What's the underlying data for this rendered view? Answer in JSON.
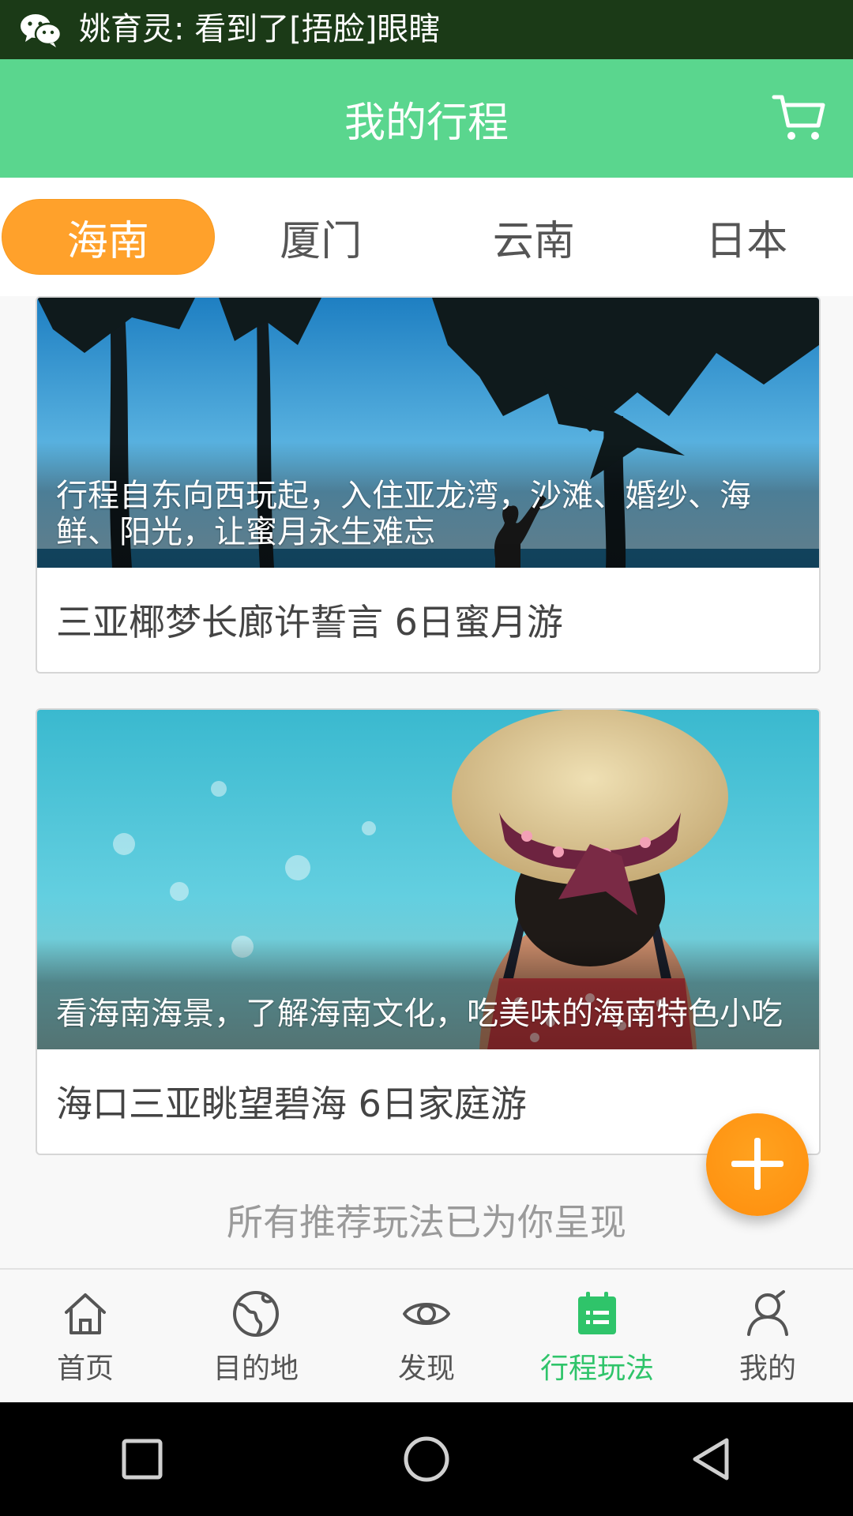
{
  "status_bar": {
    "notification_text": "姚育灵: 看到了[捂脸]眼瞎",
    "app_icon": "wechat-icon"
  },
  "header": {
    "title": "我的行程",
    "cart_icon": "shopping-cart-icon",
    "background_color": "#5ad68e"
  },
  "tabs": [
    {
      "label": "海南",
      "active": true
    },
    {
      "label": "厦门",
      "active": false
    },
    {
      "label": "云南",
      "active": false
    },
    {
      "label": "日本",
      "active": false
    }
  ],
  "cards": [
    {
      "description": "行程自东向西玩起，入住亚龙湾，沙滩、婚纱、海鲜、阳光，让蜜月永生难忘",
      "title": "三亚椰梦长廊许誓言 6日蜜月游"
    },
    {
      "description": "看海南海景，了解海南文化，吃美味的海南特色小吃",
      "title": "海口三亚眺望碧海 6日家庭游"
    }
  ],
  "end_note": "所有推荐玩法已为你呈现",
  "fab": {
    "icon": "plus-icon",
    "color": "#ff9716"
  },
  "bottom_nav": [
    {
      "label": "首页",
      "icon": "home-icon",
      "active": false
    },
    {
      "label": "目的地",
      "icon": "globe-icon",
      "active": false
    },
    {
      "label": "发现",
      "icon": "eye-icon",
      "active": false
    },
    {
      "label": "行程玩法",
      "icon": "calendar-list-icon",
      "active": true
    },
    {
      "label": "我的",
      "icon": "user-icon",
      "active": false
    }
  ],
  "system_nav": [
    {
      "icon": "recent-apps-icon"
    },
    {
      "icon": "home-circle-icon"
    },
    {
      "icon": "back-triangle-icon"
    }
  ],
  "colors": {
    "accent_green": "#2fc46a",
    "tab_active_orange": "#ffa12b"
  }
}
